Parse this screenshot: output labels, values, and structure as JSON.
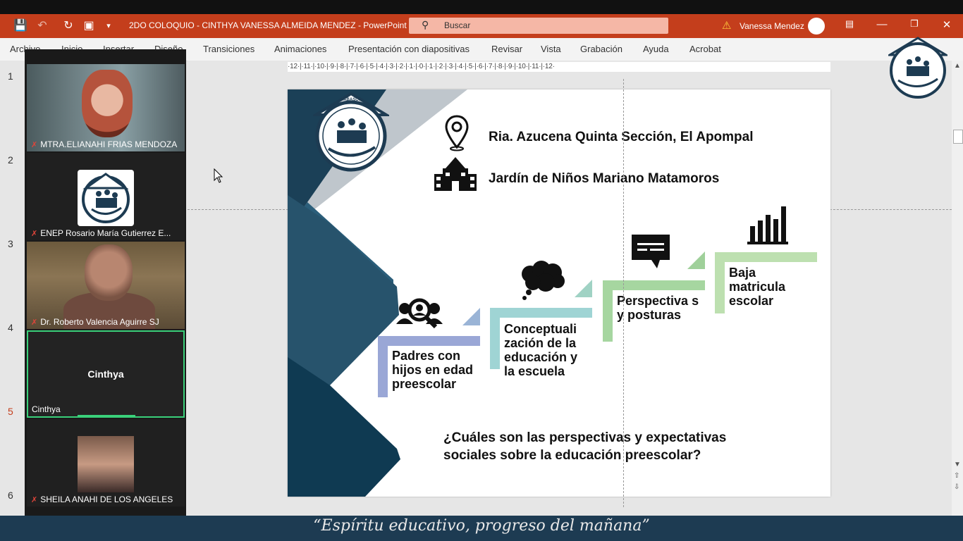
{
  "window": {
    "title": "2DO COLOQUIO - CINTHYA VANESSA ALMEIDA MENDEZ  -  PowerPoint",
    "search_placeholder": "Buscar",
    "user": "Vanessa Mendez"
  },
  "ribbon": {
    "tabs": [
      "Archivo",
      "Inicio",
      "Insertar",
      "Diseño",
      "Transiciones",
      "Animaciones",
      "Presentación con diapositivas",
      "Revisar",
      "Vista",
      "Grabación",
      "Ayuda",
      "Acrobat"
    ]
  },
  "slide_numbers": [
    "1",
    "2",
    "3",
    "4",
    "5",
    "6"
  ],
  "current_slide": "5",
  "ruler": "·12·|·11·|·10·|·9·|·8·|·7·|·6·|·5·|·4·|·3·|·2·|·1·|·0·|·1·|·2·|·3·|·4·|·5·|·6·|·7·|·8·|·9·|·10·|·11·|·12·",
  "participants": [
    {
      "name": "MTRA.ELIANAHI FRIAS MENDOZA",
      "muted": true
    },
    {
      "name": "ENEP Rosario María Gutierrez E...",
      "muted": true
    },
    {
      "name": "Dr. Roberto Valencia Aguirre SJ",
      "muted": true
    },
    {
      "name": "Cinthya",
      "label": "Cinthya",
      "muted": false,
      "active": true
    },
    {
      "name": "SHEILA ANAHI DE LOS ANGELES",
      "muted": true
    }
  ],
  "slide": {
    "location": "Ria. Azucena Quinta Sección, El Apompal",
    "school": "Jardín de Niños Mariano Matamoros",
    "logo_text": "TABASCO",
    "steps": [
      {
        "text": "Padres con hijos en edad preescolar",
        "color": "#9aa7d6"
      },
      {
        "text": "Conceptuali zación de la educación y la escuela",
        "color": "#9fd4d4"
      },
      {
        "text": "Perspectiva s y posturas",
        "color": "#a6d6a0"
      },
      {
        "text": "Baja matricula escolar",
        "color": "#bde0b0"
      }
    ],
    "question": "¿Cuáles son las perspectivas y expectativas sociales sobre la educación preescolar?"
  },
  "banner": "“Espíritu educativo, progreso del mañana”"
}
